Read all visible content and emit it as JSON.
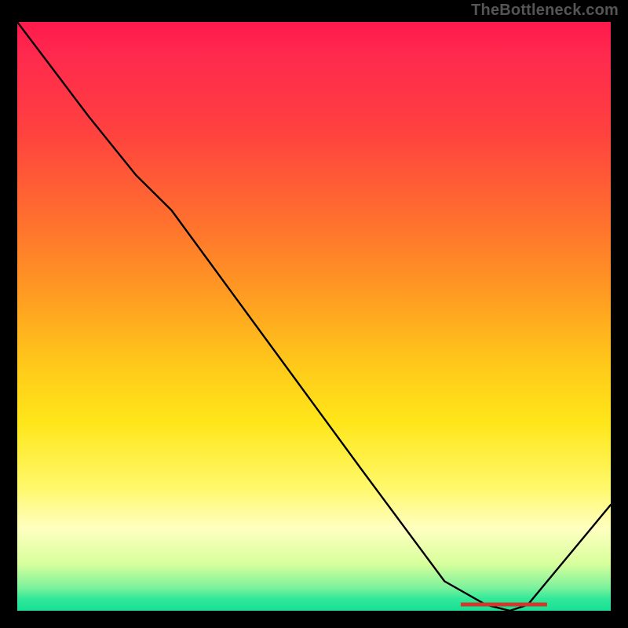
{
  "attribution": "TheBottleneck.com",
  "marker_label": "",
  "chart_data": {
    "type": "line",
    "title": "",
    "xlabel": "",
    "ylabel": "",
    "xlim": [
      0,
      100
    ],
    "ylim": [
      0,
      100
    ],
    "grid": false,
    "series": [
      {
        "name": "curve",
        "x": [
          0,
          6,
          12,
          20,
          26,
          42,
          58,
          72,
          79,
          83,
          86,
          100
        ],
        "y": [
          100,
          92,
          84,
          74,
          68,
          46,
          24,
          5,
          1,
          0,
          1,
          18
        ]
      }
    ],
    "annotations": [
      {
        "text": "",
        "x": 82,
        "y": 1
      }
    ],
    "background_gradient": {
      "direction": "vertical",
      "stops": [
        {
          "pct": 0,
          "color": "#ff1a4d"
        },
        {
          "pct": 18,
          "color": "#ff4040"
        },
        {
          "pct": 46,
          "color": "#ff9a22"
        },
        {
          "pct": 68,
          "color": "#ffe61a"
        },
        {
          "pct": 86,
          "color": "#ffffc0"
        },
        {
          "pct": 96,
          "color": "#7ff29c"
        },
        {
          "pct": 100,
          "color": "#1adf95"
        }
      ]
    }
  }
}
